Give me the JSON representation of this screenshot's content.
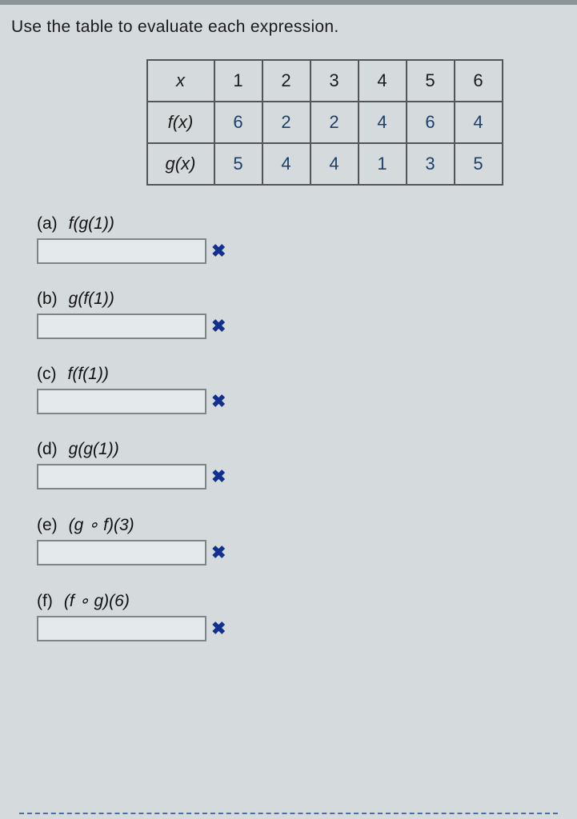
{
  "instruction": "Use the table to evaluate each expression.",
  "table": {
    "header": [
      "x",
      "1",
      "2",
      "3",
      "4",
      "5",
      "6"
    ],
    "rows": [
      {
        "label": "f(x)",
        "values": [
          "6",
          "2",
          "2",
          "4",
          "6",
          "4"
        ]
      },
      {
        "label": "g(x)",
        "values": [
          "5",
          "4",
          "4",
          "1",
          "3",
          "5"
        ]
      }
    ]
  },
  "questions": [
    {
      "tag": "(a)",
      "expr": "f(g(1))",
      "status": "wrong"
    },
    {
      "tag": "(b)",
      "expr": "g(f(1))",
      "status": "wrong"
    },
    {
      "tag": "(c)",
      "expr": "f(f(1))",
      "status": "wrong"
    },
    {
      "tag": "(d)",
      "expr": "g(g(1))",
      "status": "wrong"
    },
    {
      "tag": "(e)",
      "expr": "(g ∘ f)(3)",
      "status": "wrong"
    },
    {
      "tag": "(f)",
      "expr": "(f ∘ g)(6)",
      "status": "wrong"
    }
  ],
  "icons": {
    "wrong": "✖"
  },
  "chart_data": {
    "type": "table",
    "columns": [
      "x",
      "f(x)",
      "g(x)"
    ],
    "rows": [
      [
        1,
        6,
        5
      ],
      [
        2,
        2,
        4
      ],
      [
        3,
        2,
        4
      ],
      [
        4,
        4,
        1
      ],
      [
        5,
        6,
        3
      ],
      [
        6,
        4,
        5
      ]
    ]
  }
}
